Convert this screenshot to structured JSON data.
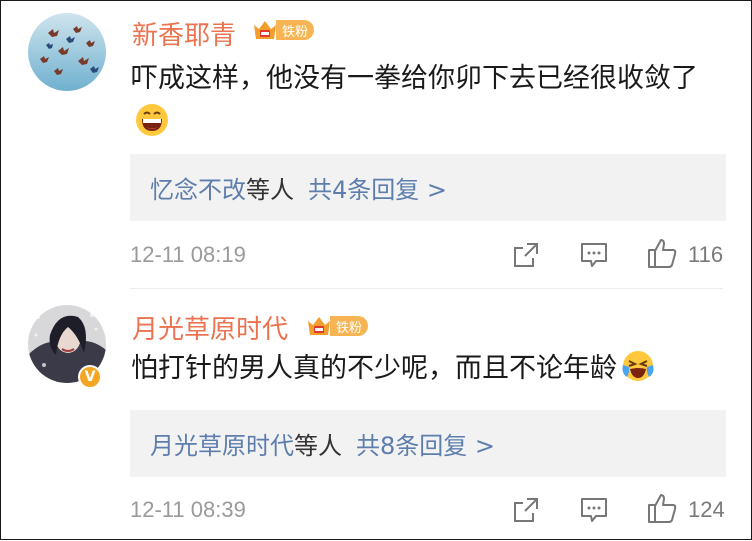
{
  "comments": [
    {
      "username": "新香耶青",
      "fan_badge": "铁粉",
      "text": "吓成这样，他没有一拳给你卯下去已经很收敛了",
      "emoji": "grinning-face-emoji",
      "reply_summary": {
        "names": "忆念不改",
        "suffix": "等人",
        "count": "共4条回复 >"
      },
      "time": "12-11 08:19",
      "likes": "116"
    },
    {
      "username": "月光草原时代",
      "fan_badge": "铁粉",
      "text": "怕打针的男人真的不少呢，而且不论年龄",
      "emoji": "laughing-tears-emoji",
      "reply_summary": {
        "names": "月光草原时代",
        "suffix": "等人",
        "count": "共8条回复 >"
      },
      "time": "12-11 08:39",
      "likes": "124"
    }
  ],
  "colors": {
    "username": "#eb7350",
    "link": "#5d7dad",
    "meta": "#9a9a9a",
    "badge": "#f6b552",
    "reply_bg": "#f2f2f2"
  },
  "icons": [
    "share-icon",
    "comment-icon",
    "like-icon",
    "crown-icon",
    "verified-icon"
  ]
}
